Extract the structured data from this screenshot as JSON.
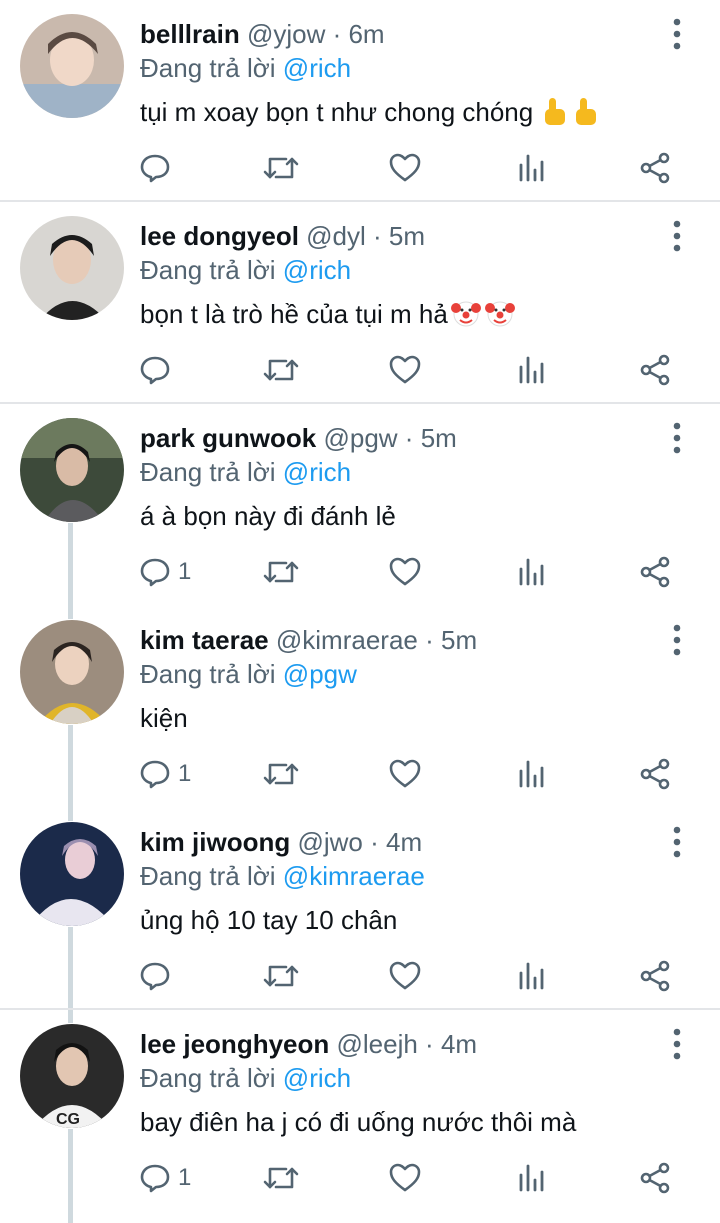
{
  "reply_prefix": "Đang trả lời",
  "tweets": [
    {
      "name": "belllrain",
      "handle": "@yjow",
      "time": "6m",
      "reply_to": "@rich",
      "text": "tụi m xoay bọn t như chong chóng",
      "emoji": "👆👆",
      "reply_count": "",
      "avatar_bg": "#c9b9ad"
    },
    {
      "name": "lee dongyeol",
      "handle": "@dyl",
      "time": "5m",
      "reply_to": "@rich",
      "text": "bọn t là trò hề của tụi m hả",
      "emoji": "🤡🤡",
      "reply_count": "",
      "avatar_bg": "#d8d6d2"
    },
    {
      "name": "park gunwook",
      "handle": "@pgw",
      "time": "5m",
      "reply_to": "@rich",
      "text": "á à bọn này đi đánh lẻ",
      "emoji": "",
      "reply_count": "1",
      "avatar_bg": "#3d4a3a"
    },
    {
      "name": "kim taerae",
      "handle": "@kimraerae",
      "time": "5m",
      "reply_to": "@pgw",
      "text": "kiện",
      "emoji": "",
      "reply_count": "1",
      "avatar_bg": "#9c8d7e"
    },
    {
      "name": "kim jiwoong",
      "handle": "@jwo",
      "time": "4m",
      "reply_to": "@kimraerae",
      "text": "ủng hộ 10 tay 10 chân",
      "emoji": "",
      "reply_count": "",
      "avatar_bg": "#1b2a4a"
    },
    {
      "name": "lee jeonghyeon",
      "handle": "@leejh",
      "time": "4m",
      "reply_to": "@rich",
      "text": "bay điên ha j có đi uống nước thôi mà",
      "emoji": "",
      "reply_count": "1",
      "avatar_bg": "#2a2a2a"
    }
  ],
  "colors": {
    "text": "#0f1419",
    "secondary": "#536471",
    "accent": "#1d9bf0",
    "divider": "#e3e5e8",
    "thread": "#cfd9de"
  },
  "icons": [
    "reply-icon",
    "retweet-icon",
    "like-icon",
    "stats-icon",
    "share-icon",
    "more-icon"
  ]
}
